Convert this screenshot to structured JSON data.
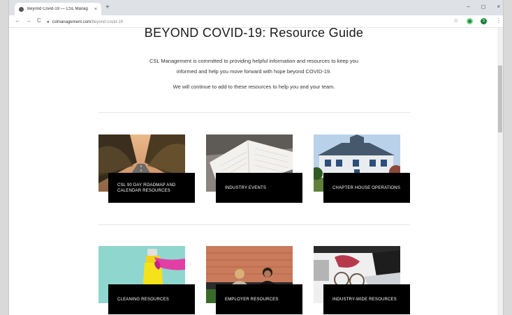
{
  "browser": {
    "tab_title": "Beyond Covid-19 — CSL Manag",
    "tab_close": "×",
    "new_tab": "+",
    "url_domain": "cslmanagement.com",
    "url_path": "/beyond-covid-19",
    "nav_back": "←",
    "nav_forward": "→",
    "nav_reload": "C",
    "star": "☆",
    "menu": "⋮",
    "lock": "🔒",
    "win_min": "–",
    "win_max": "◻",
    "win_close": "×",
    "profile_letter": "S"
  },
  "page": {
    "title": "BEYOND COVID-19: Resource Guide",
    "intro_line1": "CSL Management is committed to providing helpful information and resources to keep you",
    "intro_line2": "informed and help you move forward with hope beyond COVID-19.",
    "intro_line3": "We will continue to add to these resources to help you and your team."
  },
  "cards": [
    {
      "label": "CSL 90 DAY ROADMAP AND CALENDAR RESOURCES",
      "image": "road-through-trees"
    },
    {
      "label": "INDUSTRY EVENTS",
      "image": "open-planner-book"
    },
    {
      "label": "CHAPTER HOUSE OPERATIONS",
      "image": "house-exterior"
    },
    {
      "label": "CLEANING RESOURCES",
      "image": "spray-bottle-glove"
    },
    {
      "label": "EMPLOYER RESOURCES",
      "image": "two-women-office"
    },
    {
      "label": "INDUSTRY-WIDE RESOURCES",
      "image": "desk-laptop-glasses"
    }
  ],
  "colors": {
    "card_label_bg": "#000000",
    "chrome_bg": "#dee1e6",
    "accent_green": "#1e8e3e"
  }
}
